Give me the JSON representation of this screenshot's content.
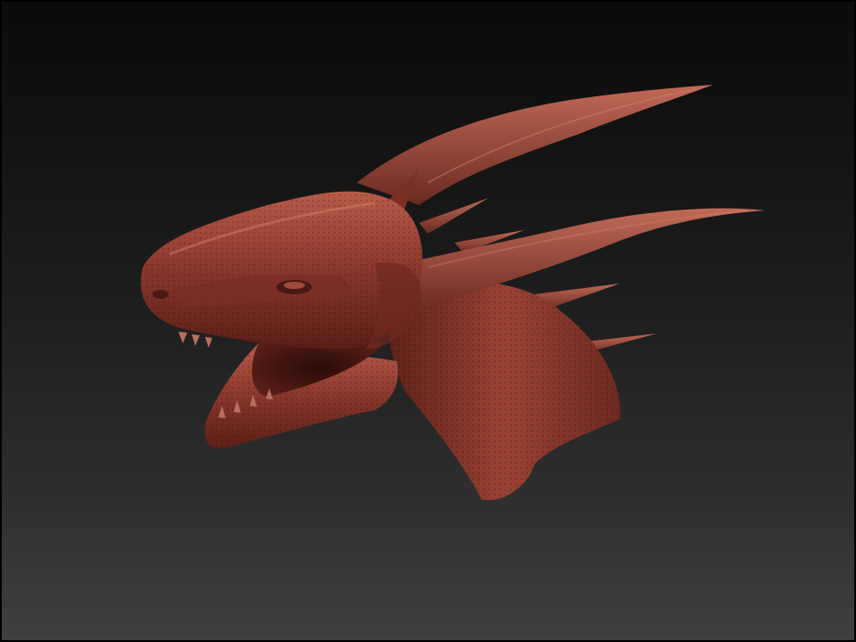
{
  "viewport": {
    "background_top": "#0b0b0b",
    "background_bottom": "#3f3f3f"
  },
  "model": {
    "subject": "dragon-head-sculpt",
    "material_color": "#8f3a2e",
    "shadow_color": "#4a1812",
    "highlight_color": "#c76a57"
  }
}
